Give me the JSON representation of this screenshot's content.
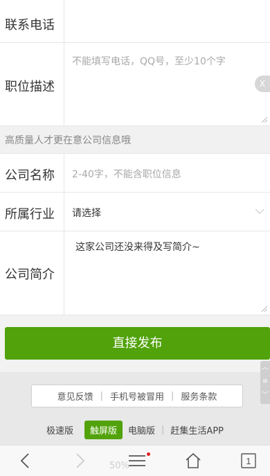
{
  "form": {
    "phone": {
      "label": "联系电话"
    },
    "description": {
      "label": "职位描述",
      "placeholder": "不能填写电话，QQ号，至少10个字",
      "clear_label": "X"
    },
    "section_hint": "高质量人才更在意公司信息哦",
    "company_name": {
      "label": "公司名称",
      "placeholder": "2-40字，不能含职位信息"
    },
    "industry": {
      "label": "所属行业",
      "value": "请选择"
    },
    "company_intro": {
      "label": "公司简介",
      "value": "这家公司还没来得及写简介~"
    }
  },
  "publish_label": "直接发布",
  "footer": {
    "links": [
      "意见反馈",
      "手机号被冒用",
      "服务条款"
    ],
    "versions": [
      "极速版",
      "触屏版",
      "电脑版",
      "赶集生活APP"
    ],
    "active_version": "触屏版"
  },
  "browser": {
    "zoom_text": "50%",
    "tab_count": "1",
    "accent_color": "#51a20b"
  }
}
